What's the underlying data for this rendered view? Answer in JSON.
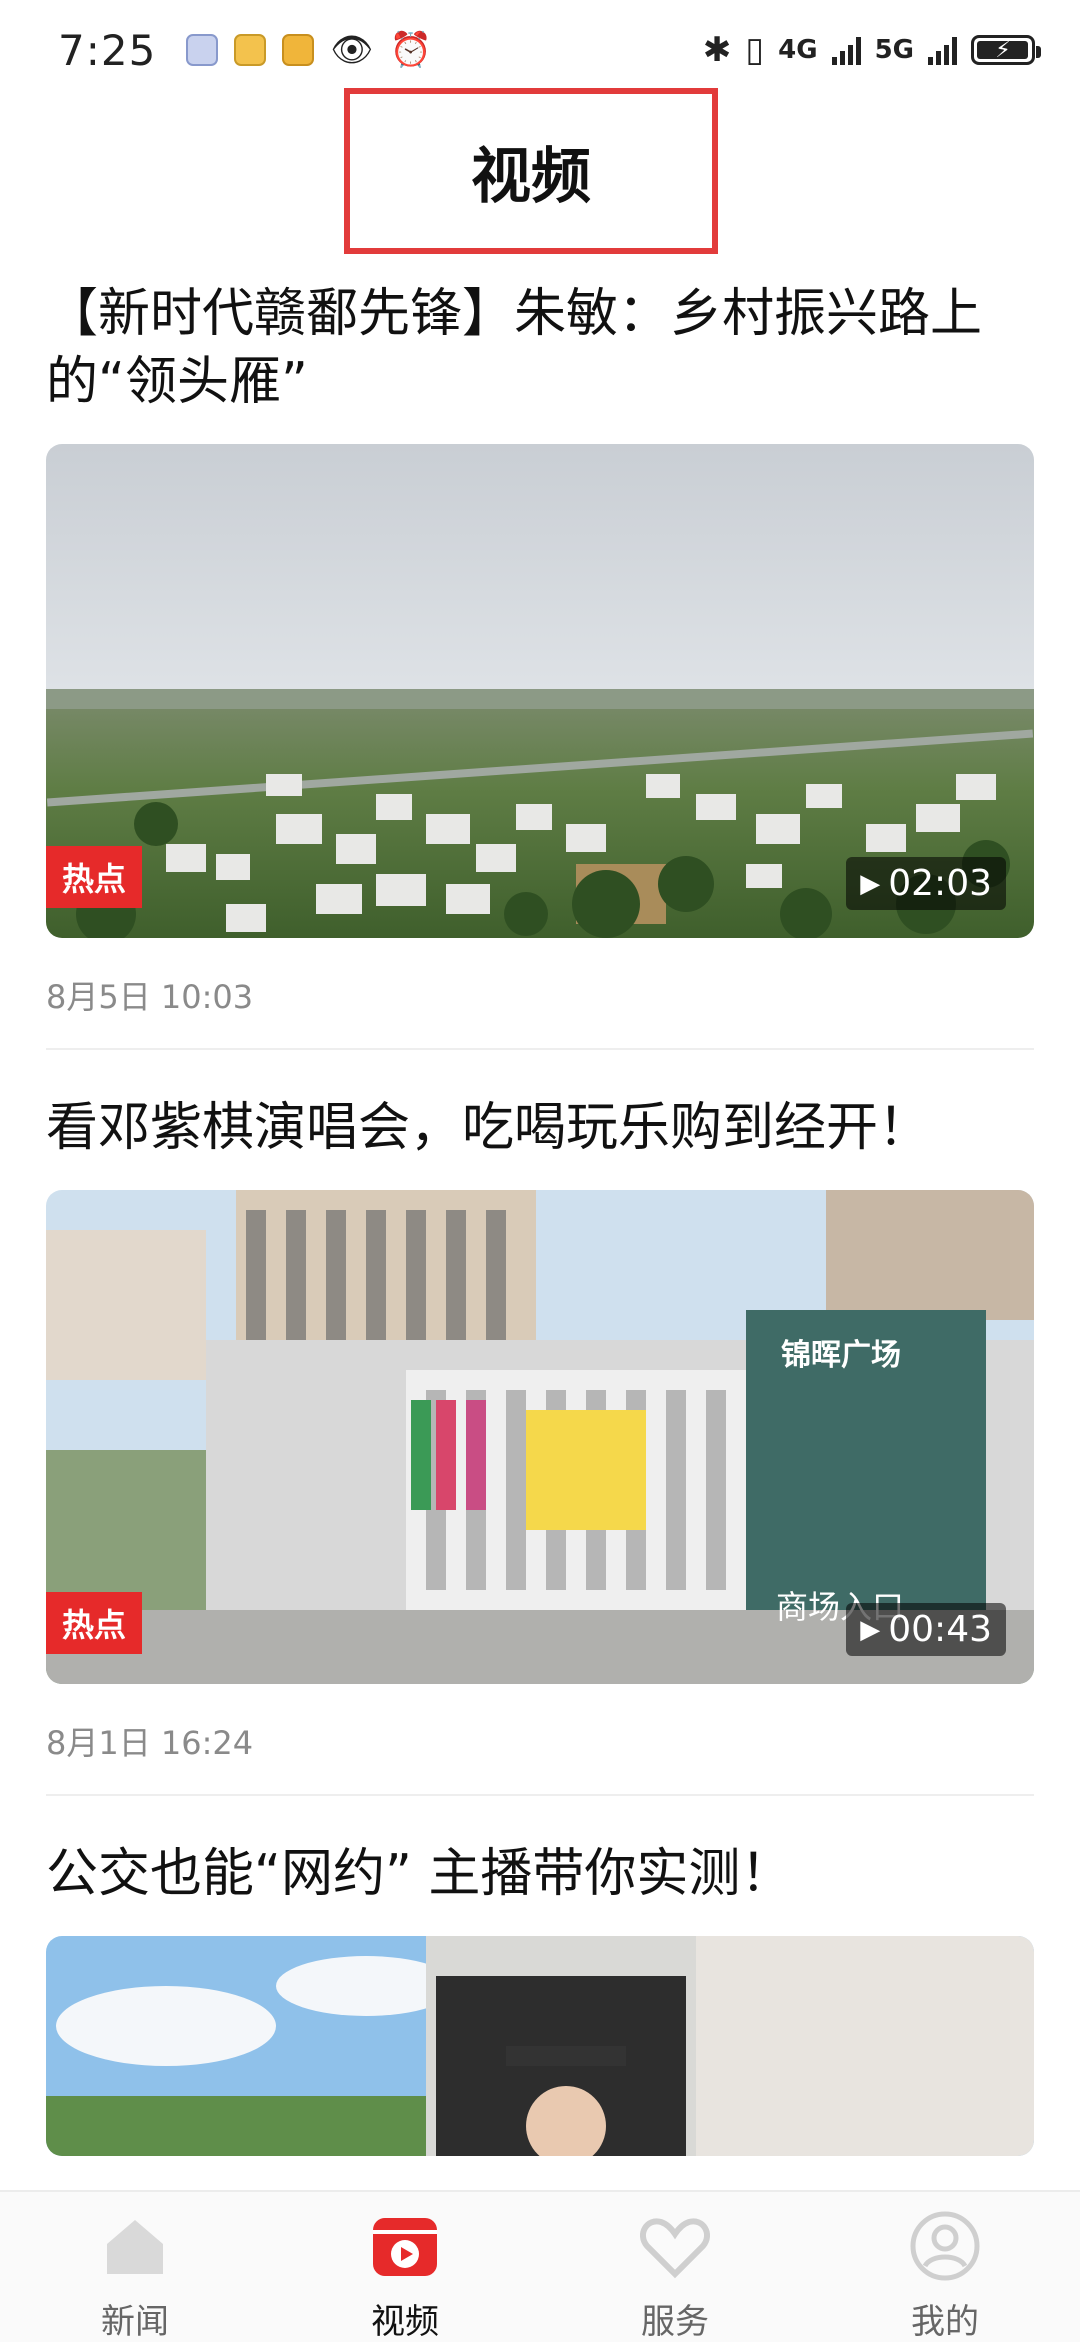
{
  "status_bar": {
    "time": "7:25",
    "net1": "4G",
    "net2": "5G"
  },
  "header": {
    "title": "视频"
  },
  "feed": [
    {
      "title": "【新时代赣鄱先锋】朱敏：乡村振兴路上的“领头雁”",
      "tag": "热点",
      "duration": "02:03",
      "date": "8月5日 10:03"
    },
    {
      "title": "看邓紫棋演唱会，吃喝玩乐购到经开！",
      "tag": "热点",
      "duration": "00:43",
      "date": "8月1日 16:24",
      "overlay_sign": "锦晖广场",
      "overlay_entrance": "商场入口"
    },
    {
      "title": "公交也能“网约” 主播带你实测！"
    }
  ],
  "bottom_nav": [
    {
      "label": "新闻",
      "icon": "home-icon",
      "active": false
    },
    {
      "label": "视频",
      "icon": "video-icon",
      "active": true
    },
    {
      "label": "服务",
      "icon": "heart-hands-icon",
      "active": false
    },
    {
      "label": "我的",
      "icon": "user-icon",
      "active": false
    }
  ],
  "colors": {
    "accent": "#e62a2a",
    "header_box": "#e23b3b"
  }
}
